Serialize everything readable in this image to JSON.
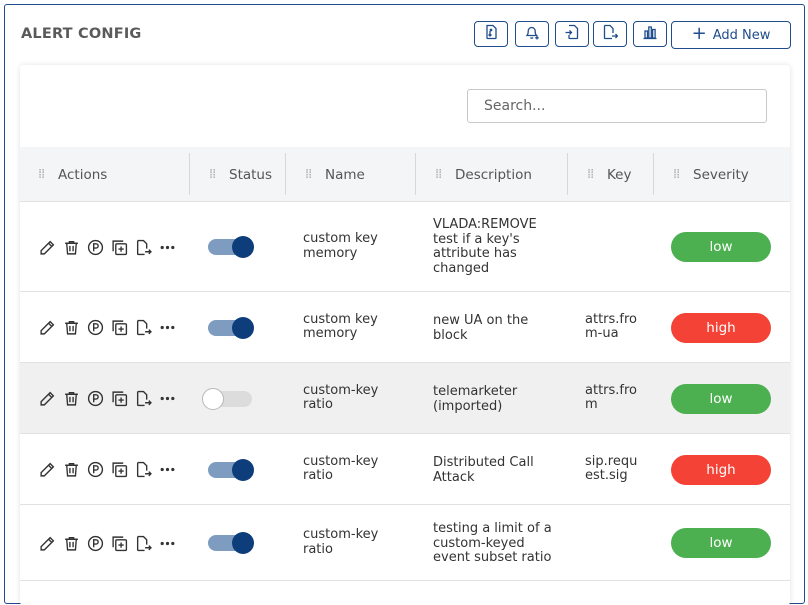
{
  "header": {
    "title": "ALERT CONFIG",
    "toolbar": [
      {
        "name": "import-config-button",
        "icon": "document-import-icon"
      },
      {
        "name": "add-notification-button",
        "icon": "bell-plus-icon"
      },
      {
        "name": "import-file-button",
        "icon": "file-import-icon"
      },
      {
        "name": "export-file-button",
        "icon": "file-export-icon"
      },
      {
        "name": "chart-button",
        "icon": "bar-chart-icon"
      }
    ],
    "add_new_label": "Add New"
  },
  "search": {
    "placeholder": "Search..."
  },
  "table": {
    "columns": [
      "Actions",
      "Status",
      "Name",
      "Description",
      "Key",
      "Severity"
    ],
    "rows": [
      {
        "enabled": true,
        "name": "custom key memory",
        "description": "VLADA:REMOVE test if a key's attribute has changed",
        "key": "",
        "severity": "low"
      },
      {
        "enabled": true,
        "name": "custom key memory",
        "description": "new UA on the block",
        "key": "attrs.from-ua",
        "severity": "high"
      },
      {
        "enabled": false,
        "name": "custom-key ratio",
        "description": "telemarketer (imported)",
        "key": "attrs.from",
        "severity": "low"
      },
      {
        "enabled": true,
        "name": "custom-key ratio",
        "description": "Distributed Call Attack",
        "key": "sip.request.sig",
        "severity": "high"
      },
      {
        "enabled": true,
        "name": "custom-key ratio",
        "description": "testing a limit of a custom-keyed event subset ratio",
        "key": "",
        "severity": "low"
      }
    ],
    "row_actions": [
      "edit-icon",
      "delete-icon",
      "parameters-icon",
      "duplicate-icon",
      "export-icon",
      "more-icon"
    ]
  },
  "colors": {
    "brand": "#1f4c8a",
    "low": "#4caf50",
    "high": "#f44336",
    "toggle_on": "#0d3d7a"
  }
}
